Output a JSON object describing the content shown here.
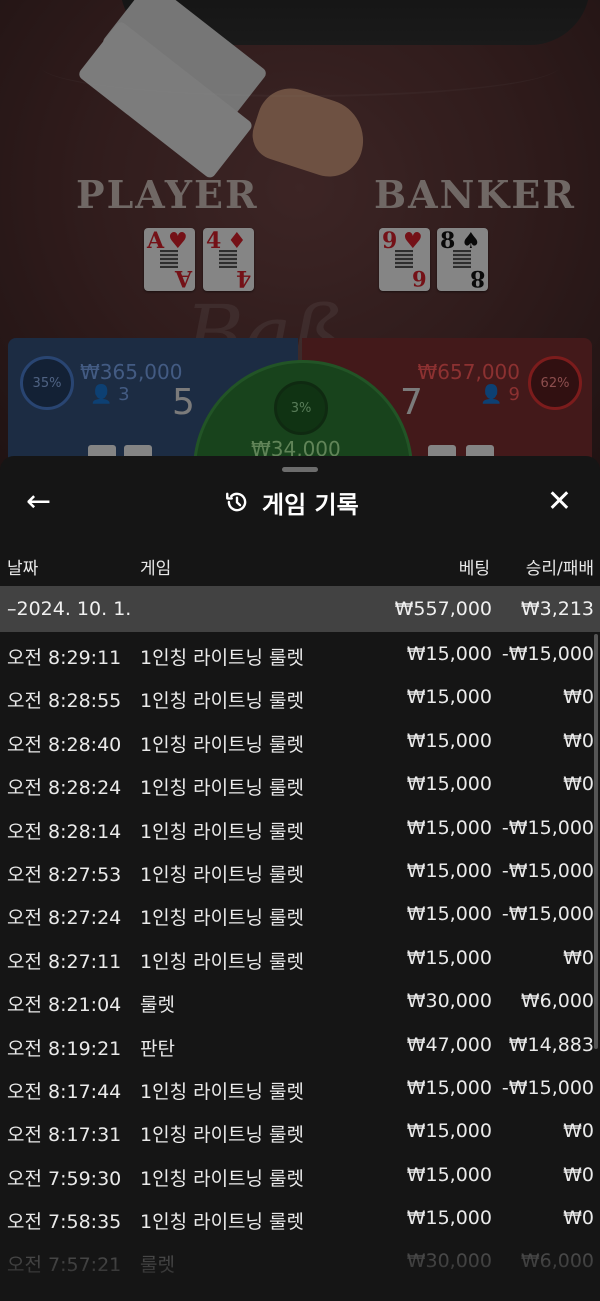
{
  "game": {
    "player_label": "PLAYER",
    "banker_label": "BANKER",
    "player_cards": [
      {
        "rank": "A",
        "suit": "♥",
        "color": "red"
      },
      {
        "rank": "4",
        "suit": "♦",
        "color": "red"
      }
    ],
    "banker_cards": [
      {
        "rank": "9",
        "suit": "♥",
        "color": "red"
      },
      {
        "rank": "8",
        "suit": "♠",
        "color": "black"
      }
    ],
    "player": {
      "percent": "35%",
      "amount": "₩365,000",
      "players": "3",
      "score": "5"
    },
    "banker": {
      "percent": "62%",
      "amount": "₩657,000",
      "players": "9",
      "score": "7"
    },
    "tie": {
      "percent": "3%",
      "amount": "₩34,000"
    }
  },
  "history": {
    "title": "게임 기록",
    "back_icon": "arrow-left-icon",
    "close_icon": "close-icon",
    "history_icon": "history-icon",
    "columns": {
      "date": "날짜",
      "game": "게임",
      "bet": "베팅",
      "result": "승리/패배"
    },
    "summary": {
      "date": "–2024. 10. 1.",
      "bet": "₩557,000",
      "result": "₩3,213"
    },
    "rows": [
      {
        "date": "오전 8:29:11",
        "game": "1인칭 라이트닝 룰렛",
        "bet": "₩15,000",
        "result": "-₩15,000"
      },
      {
        "date": "오전 8:28:55",
        "game": "1인칭 라이트닝 룰렛",
        "bet": "₩15,000",
        "result": "₩0"
      },
      {
        "date": "오전 8:28:40",
        "game": "1인칭 라이트닝 룰렛",
        "bet": "₩15,000",
        "result": "₩0"
      },
      {
        "date": "오전 8:28:24",
        "game": "1인칭 라이트닝 룰렛",
        "bet": "₩15,000",
        "result": "₩0"
      },
      {
        "date": "오전 8:28:14",
        "game": "1인칭 라이트닝 룰렛",
        "bet": "₩15,000",
        "result": "-₩15,000"
      },
      {
        "date": "오전 8:27:53",
        "game": "1인칭 라이트닝 룰렛",
        "bet": "₩15,000",
        "result": "-₩15,000"
      },
      {
        "date": "오전 8:27:24",
        "game": "1인칭 라이트닝 룰렛",
        "bet": "₩15,000",
        "result": "-₩15,000"
      },
      {
        "date": "오전 8:27:11",
        "game": "1인칭 라이트닝 룰렛",
        "bet": "₩15,000",
        "result": "₩0"
      },
      {
        "date": "오전 8:21:04",
        "game": "룰렛",
        "bet": "₩30,000",
        "result": "₩6,000"
      },
      {
        "date": "오전 8:19:21",
        "game": "판탄",
        "bet": "₩47,000",
        "result": "₩14,883"
      },
      {
        "date": "오전 8:17:44",
        "game": "1인칭 라이트닝 룰렛",
        "bet": "₩15,000",
        "result": "-₩15,000"
      },
      {
        "date": "오전 8:17:31",
        "game": "1인칭 라이트닝 룰렛",
        "bet": "₩15,000",
        "result": "₩0"
      },
      {
        "date": "오전 7:59:30",
        "game": "1인칭 라이트닝 룰렛",
        "bet": "₩15,000",
        "result": "₩0"
      },
      {
        "date": "오전 7:58:35",
        "game": "1인칭 라이트닝 룰렛",
        "bet": "₩15,000",
        "result": "₩0"
      },
      {
        "date": "오전 7:57:21",
        "game": "룰렛",
        "bet": "₩30,000",
        "result": "₩6,000"
      }
    ]
  }
}
